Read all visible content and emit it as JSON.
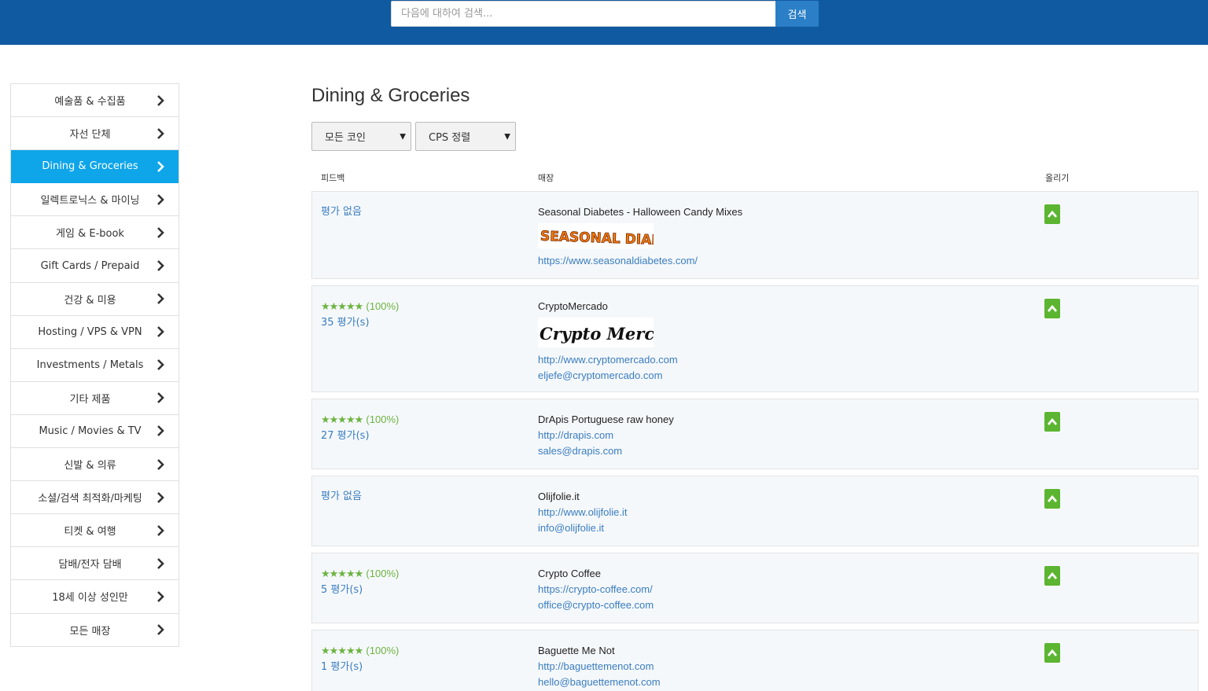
{
  "search": {
    "placeholder": "다음에 대하여 검색...",
    "button_label": "검색"
  },
  "sidebar": {
    "items": [
      {
        "label": "예술품 & 수집품",
        "active": false
      },
      {
        "label": "자선 단체",
        "active": false
      },
      {
        "label": "Dining & Groceries",
        "active": true
      },
      {
        "label": "일렉트로닉스 & 마이닝",
        "active": false
      },
      {
        "label": "게임 & E-book",
        "active": false
      },
      {
        "label": "Gift Cards / Prepaid",
        "active": false
      },
      {
        "label": "건강 & 미용",
        "active": false
      },
      {
        "label": "Hosting / VPS & VPN",
        "active": false
      },
      {
        "label": "Investments / Metals",
        "active": false
      },
      {
        "label": "기타 제품",
        "active": false
      },
      {
        "label": "Music / Movies & TV",
        "active": false
      },
      {
        "label": "신발 & 의류",
        "active": false
      },
      {
        "label": "소셜/검색 최적화/마케팅",
        "active": false
      },
      {
        "label": "티켓 & 여행",
        "active": false
      },
      {
        "label": "담배/전자 담배",
        "active": false
      },
      {
        "label": "18세 이상 성인만",
        "active": false
      },
      {
        "label": "모든 매장",
        "active": false
      }
    ]
  },
  "main": {
    "title": "Dining & Groceries",
    "filters": {
      "coin_selected": "모든 코인",
      "sort_selected": "CPS 정렬"
    },
    "columns": {
      "feedback": "피드백",
      "store": "매장",
      "upvote": "올리기"
    },
    "stars": "★★★★★",
    "merchants": [
      {
        "no_rating": "평가 없음",
        "name": "Seasonal Diabetes - Halloween Candy Mixes",
        "logo_text": "SEASONAL DIABETES",
        "links": [
          "https://www.seasonaldiabetes.com/"
        ]
      },
      {
        "percent": "(100%)",
        "count": "35 평가(s)",
        "name": "CryptoMercado",
        "logo_text": "Crypto Mercado",
        "links": [
          "http://www.cryptomercado.com",
          "eljefe@cryptomercado.com"
        ]
      },
      {
        "percent": "(100%)",
        "count": "27 평가(s)",
        "name": "DrApis Portuguese raw honey",
        "links": [
          "http://drapis.com",
          "sales@drapis.com"
        ]
      },
      {
        "no_rating": "평가 없음",
        "name": "Olijfolie.it",
        "links": [
          "http://www.olijfolie.it",
          "info@olijfolie.it"
        ]
      },
      {
        "percent": "(100%)",
        "count": "5 평가(s)",
        "name": "Crypto Coffee",
        "links": [
          "https://crypto-coffee.com/",
          "office@crypto-coffee.com"
        ]
      },
      {
        "percent": "(100%)",
        "count": "1 평가(s)",
        "name": "Baguette Me Not",
        "links": [
          "http://baguettemenot.com",
          "hello@baguettemenot.com"
        ]
      }
    ]
  },
  "colors": {
    "header_bg": "#0f5aa0",
    "active_bg": "#0ea5e9",
    "link": "#3a7dbf",
    "star": "#6cb33f",
    "upvote": "#5cb531"
  }
}
